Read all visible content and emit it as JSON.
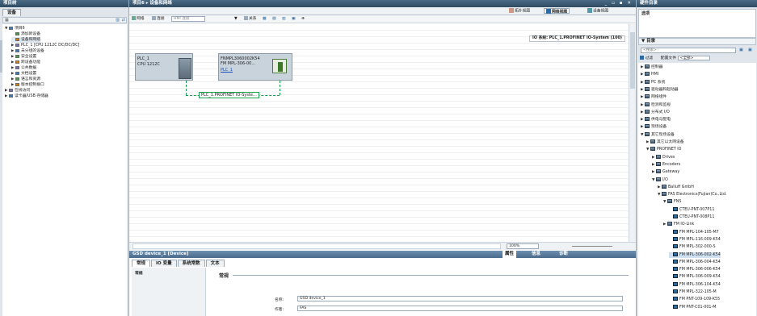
{
  "left": {
    "panel_title": "项目树",
    "tab_devices": "设备",
    "tree": [
      {
        "label": "项目6",
        "indent": 0,
        "arrow": "▼",
        "icon": "project"
      },
      {
        "label": "添加新设备",
        "indent": 1,
        "arrow": "",
        "icon": "add-device"
      },
      {
        "label": "设备和网络",
        "indent": 1,
        "arrow": "",
        "icon": "network"
      },
      {
        "label": "PLC_1 [CPU 1212C DC/DC/DC]",
        "indent": 1,
        "arrow": "▶",
        "icon": "plc"
      },
      {
        "label": "未分组的设备",
        "indent": 1,
        "arrow": "▶",
        "icon": "folder"
      },
      {
        "label": "安全设置",
        "indent": 1,
        "arrow": "▶",
        "icon": "security"
      },
      {
        "label": "跨设备功能",
        "indent": 1,
        "arrow": "▶",
        "icon": "cross-device"
      },
      {
        "label": "公共数据",
        "indent": 1,
        "arrow": "▶",
        "icon": "folder"
      },
      {
        "label": "文档设置",
        "indent": 1,
        "arrow": "▶",
        "icon": "document"
      },
      {
        "label": "语言和资源",
        "indent": 1,
        "arrow": "▶",
        "icon": "language"
      },
      {
        "label": "版本控制接口",
        "indent": 1,
        "arrow": "▶",
        "icon": "version"
      },
      {
        "label": "在线访问",
        "indent": 0,
        "arrow": "▶",
        "icon": "online"
      },
      {
        "label": "读卡器/USB 存储器",
        "indent": 0,
        "arrow": "▶",
        "icon": "card-reader"
      }
    ],
    "side_tab": "设备和网络"
  },
  "center": {
    "breadcrumb": "项目6 ▸ 设备和网络",
    "view_topology": "拓扑视图",
    "view_network": "网络视图",
    "view_device": "设备视图",
    "tool_network": "网络",
    "tool_connections": "连接",
    "conn_type": "HMI 连接",
    "tool_relations": "关系",
    "io_system_label": "IO 系统: PLC_1.PROFINET IO-System (100)",
    "plc": {
      "name": "PLC_1",
      "type": "CPU 1212C"
    },
    "io_device": {
      "name": "FNMPL3060002K54",
      "type": "FM MPL-306-00...",
      "link": "PLC_1"
    },
    "profinet_label": "PLC_1.PROFINET IO-Syste...",
    "zoom": "100%"
  },
  "inspector": {
    "title": "GSD device_1 [Device]",
    "tab_properties": "属性",
    "tab_info": "信息",
    "tab_diagnostics": "诊断",
    "tabs": [
      "常规",
      "IO 变量",
      "系统常数",
      "文本"
    ],
    "nav_general": "常规",
    "section_general": "常规",
    "name_label": "名称:",
    "name_value": "GSD device_1",
    "author_label": "作者:",
    "author_value": "FAS"
  },
  "catalog": {
    "panel_title": "硬件目录",
    "options_label": "选项",
    "catalog_header": "目录",
    "search_placeholder": "<搜索>",
    "filter_label": "过滤",
    "profile_label": "配置文件",
    "profile_value": "<全部>",
    "items": [
      {
        "label": "控制器",
        "indent": 0,
        "arrow": "▶"
      },
      {
        "label": "HMI",
        "indent": 0,
        "arrow": "▶"
      },
      {
        "label": "PC 系统",
        "indent": 0,
        "arrow": "▶"
      },
      {
        "label": "驱动器和起动器",
        "indent": 0,
        "arrow": "▶"
      },
      {
        "label": "网络组件",
        "indent": 0,
        "arrow": "▶"
      },
      {
        "label": "检测和监视",
        "indent": 0,
        "arrow": "▶"
      },
      {
        "label": "分布式 I/O",
        "indent": 0,
        "arrow": "▶"
      },
      {
        "label": "供电与配电",
        "indent": 0,
        "arrow": "▶"
      },
      {
        "label": "现场设备",
        "indent": 0,
        "arrow": "▶"
      },
      {
        "label": "其它现场设备",
        "indent": 0,
        "arrow": "▼"
      },
      {
        "label": "其它以太网设备",
        "indent": 1,
        "arrow": "▶"
      },
      {
        "label": "PROFINET IO",
        "indent": 1,
        "arrow": "▼"
      },
      {
        "label": "Drives",
        "indent": 2,
        "arrow": "▶"
      },
      {
        "label": "Encoders",
        "indent": 2,
        "arrow": "▶"
      },
      {
        "label": "Gateway",
        "indent": 2,
        "arrow": "▶"
      },
      {
        "label": "I/O",
        "indent": 2,
        "arrow": "▼"
      },
      {
        "label": "Balluff GmbH",
        "indent": 3,
        "arrow": "▶"
      },
      {
        "label": "FAS Electronics(Fujian)Co.,Ltd.",
        "indent": 3,
        "arrow": "▼"
      },
      {
        "label": "FNS",
        "indent": 4,
        "arrow": "▼"
      },
      {
        "label": "CTEU-PNT-007P11",
        "indent": 5,
        "arrow": "",
        "dev": true
      },
      {
        "label": "CTEU-PNT-008P11",
        "indent": 5,
        "arrow": "",
        "dev": true
      },
      {
        "label": "FM IO-Link",
        "indent": 4,
        "arrow": "▶"
      },
      {
        "label": "FM MPL-104-105-M7",
        "indent": 5,
        "arrow": "",
        "dev": true
      },
      {
        "label": "FM MPL-116-009-K54",
        "indent": 5,
        "arrow": "",
        "dev": true
      },
      {
        "label": "FM MPL-302-000-S",
        "indent": 5,
        "arrow": "",
        "dev": true
      },
      {
        "label": "FM MPL-306-002-K54",
        "indent": 5,
        "arrow": "",
        "dev": true,
        "selected": true
      },
      {
        "label": "FM MPL-306-004-K54",
        "indent": 5,
        "arrow": "",
        "dev": true
      },
      {
        "label": "FM MPL-306-006-K54",
        "indent": 5,
        "arrow": "",
        "dev": true
      },
      {
        "label": "FM MPL-306-009-K54",
        "indent": 5,
        "arrow": "",
        "dev": true
      },
      {
        "label": "FM MPL-306-104-K54",
        "indent": 5,
        "arrow": "",
        "dev": true
      },
      {
        "label": "FM MPL-322-105-M",
        "indent": 5,
        "arrow": "",
        "dev": true
      },
      {
        "label": "FM PNT-109-109-K55",
        "indent": 5,
        "arrow": "",
        "dev": true
      },
      {
        "label": "FM PNT-C01-001-M",
        "indent": 5,
        "arrow": "",
        "dev": true
      }
    ]
  }
}
